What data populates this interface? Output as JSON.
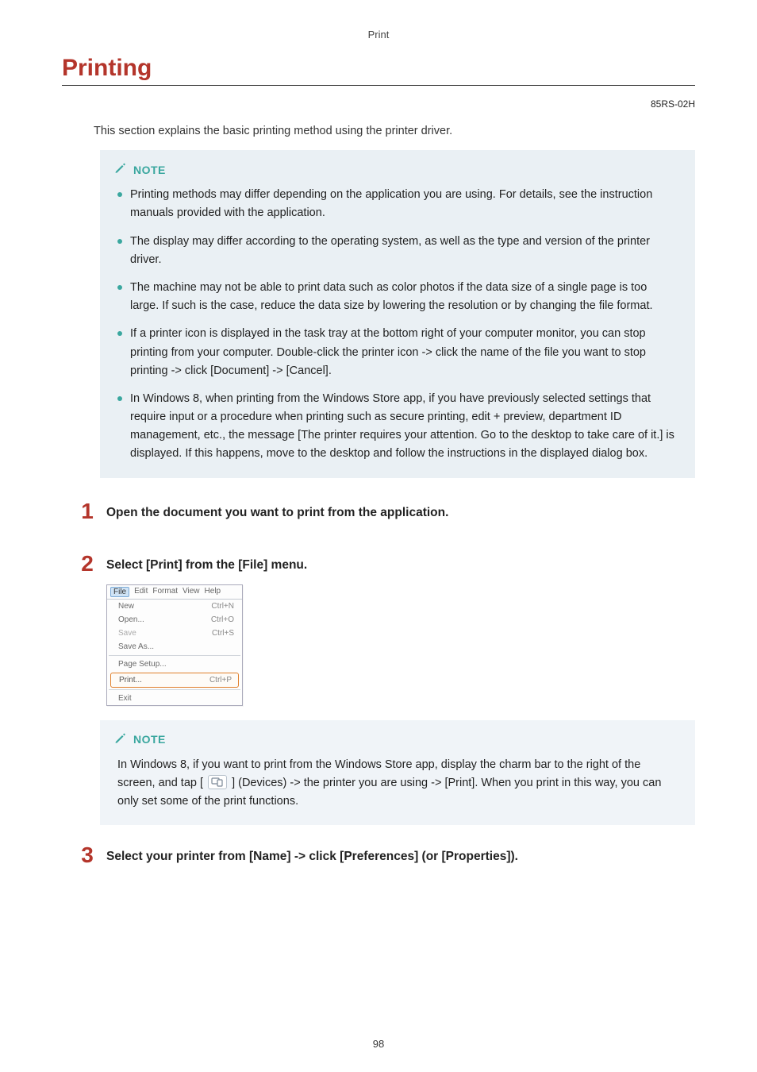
{
  "header": {
    "breadcrumb": "Print"
  },
  "title": "Printing",
  "doc_code": "85RS-02H",
  "intro": "This section explains the basic printing method using the printer driver.",
  "note_label": "NOTE",
  "note1_items": [
    "Printing methods may differ depending on the application you are using. For details, see the instruction manuals provided with the application.",
    "The display may differ according to the operating system, as well as the type and version of the printer driver.",
    "The machine may not be able to print data such as color photos if the data size of a single page is too large. If such is the case, reduce the data size by lowering the resolution or by changing the file format.",
    "If a printer icon is displayed in the task tray at the bottom right of your computer monitor, you can stop printing from your computer. Double-click the printer icon -> click the name of the file you want to stop printing -> click [Document] -> [Cancel].",
    "In Windows 8, when printing from the Windows Store app, if you have previously selected settings that require input or a procedure when printing such as secure printing, edit + preview, department ID management, etc., the message [The printer requires your attention. Go to the desktop to take care of it.] is displayed. If this happens, move to the desktop and follow the instructions in the displayed dialog box."
  ],
  "steps": {
    "s1": {
      "num": "1",
      "text": "Open the document you want to print from the application."
    },
    "s2": {
      "num": "2",
      "text": "Select [Print] from the [File] menu."
    },
    "s3": {
      "num": "3",
      "text": "Select your printer from [Name] -> click [Preferences] (or [Properties])."
    }
  },
  "menu": {
    "bar": [
      "File",
      "Edit",
      "Format",
      "View",
      "Help"
    ],
    "items": [
      {
        "label": "New",
        "shortcut": "Ctrl+N"
      },
      {
        "label": "Open...",
        "shortcut": "Ctrl+O"
      },
      {
        "label": "Save",
        "shortcut": "Ctrl+S"
      },
      {
        "label": "Save As...",
        "shortcut": ""
      }
    ],
    "sep_items": [
      {
        "label": "Page Setup...",
        "shortcut": ""
      }
    ],
    "highlight": {
      "label": "Print...",
      "shortcut": "Ctrl+P"
    },
    "exit": {
      "label": "Exit",
      "shortcut": ""
    }
  },
  "note2": {
    "pre": "In Windows 8, if you want to print from the Windows Store app, display the charm bar to the right of the screen, and tap [",
    "post": "] (Devices) -> the printer you are using -> [Print]. When you print in this way, you can only set some of the print functions."
  },
  "page_number": "98"
}
